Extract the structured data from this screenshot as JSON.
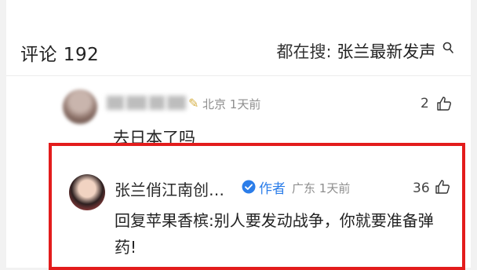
{
  "header": {
    "comment_count": "评论 192",
    "trending_label": "都在搜:",
    "trending_query": "张兰最新发声"
  },
  "comments": [
    {
      "location": "北京",
      "time": "1天前",
      "likes": "2",
      "text": "去日本了吗"
    },
    {
      "author": "张兰俏江南创…",
      "author_tag": "作者",
      "location": "广东",
      "time": "1天前",
      "likes": "36",
      "text": "回复苹果香槟:别人要发动战争，你就要准备弹药!"
    }
  ],
  "colors": {
    "highlight_border": "#e31c1c",
    "author_tag": "#2b7de9",
    "meta_text": "#8e8e8e"
  }
}
